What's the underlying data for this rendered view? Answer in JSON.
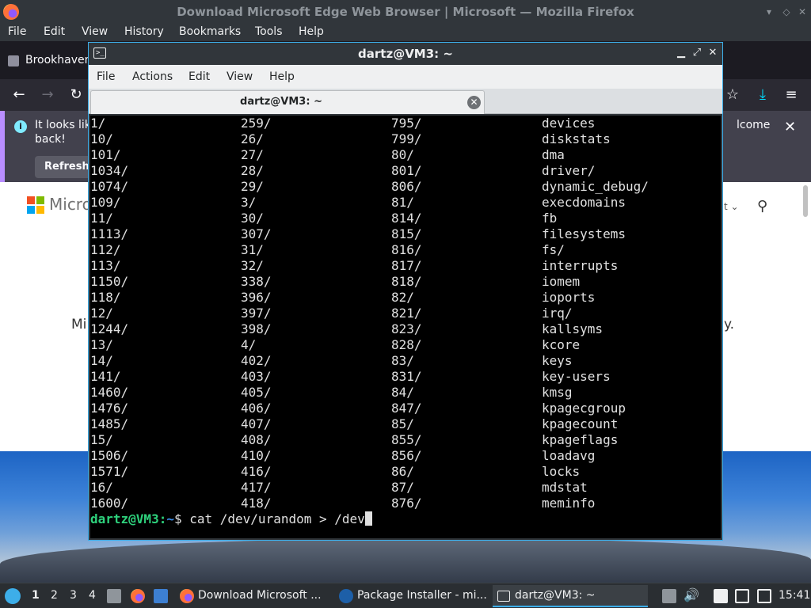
{
  "firefox": {
    "window_title": "Download Microsoft Edge Web Browser | Microsoft — Mozilla Firefox",
    "menu": [
      "File",
      "Edit",
      "View",
      "History",
      "Bookmarks",
      "Tools",
      "Help"
    ],
    "tab_title": "Brookhaven",
    "notice": {
      "line1": "It looks lik",
      "line2": "back!",
      "line1_right": "lcome",
      "refresh_label": "Refresh"
    },
    "content": {
      "ms_text": "Micro",
      "body_left": "Mi",
      "body_right": "y."
    }
  },
  "terminal": {
    "window_title": "dartz@VM3: ~",
    "menu": [
      "File",
      "Actions",
      "Edit",
      "View",
      "Help"
    ],
    "tab_title": "dartz@VM3: ~",
    "rows": [
      [
        "1/",
        "259/",
        "795/",
        "devices"
      ],
      [
        "10/",
        "26/",
        "799/",
        "diskstats"
      ],
      [
        "101/",
        "27/",
        "80/",
        "dma"
      ],
      [
        "1034/",
        "28/",
        "801/",
        "driver/"
      ],
      [
        "1074/",
        "29/",
        "806/",
        "dynamic_debug/"
      ],
      [
        "109/",
        "3/",
        "81/",
        "execdomains"
      ],
      [
        "11/",
        "30/",
        "814/",
        "fb"
      ],
      [
        "1113/",
        "307/",
        "815/",
        "filesystems"
      ],
      [
        "112/",
        "31/",
        "816/",
        "fs/"
      ],
      [
        "113/",
        "32/",
        "817/",
        "interrupts"
      ],
      [
        "1150/",
        "338/",
        "818/",
        "iomem"
      ],
      [
        "118/",
        "396/",
        "82/",
        "ioports"
      ],
      [
        "12/",
        "397/",
        "821/",
        "irq/"
      ],
      [
        "1244/",
        "398/",
        "823/",
        "kallsyms"
      ],
      [
        "13/",
        "4/",
        "828/",
        "kcore"
      ],
      [
        "14/",
        "402/",
        "83/",
        "keys"
      ],
      [
        "141/",
        "403/",
        "831/",
        "key-users"
      ],
      [
        "1460/",
        "405/",
        "84/",
        "kmsg"
      ],
      [
        "1476/",
        "406/",
        "847/",
        "kpagecgroup"
      ],
      [
        "1485/",
        "407/",
        "85/",
        "kpagecount"
      ],
      [
        "15/",
        "408/",
        "855/",
        "kpageflags"
      ],
      [
        "1506/",
        "410/",
        "856/",
        "loadavg"
      ],
      [
        "1571/",
        "416/",
        "86/",
        "locks"
      ],
      [
        "16/",
        "417/",
        "87/",
        "mdstat"
      ],
      [
        "1600/",
        "418/",
        "876/",
        "meminfo"
      ]
    ],
    "prompt_user": "dartz@VM3:",
    "prompt_path": "~",
    "prompt_symbol": "$ ",
    "command": "cat /dev/urandom > /dev"
  },
  "taskbar": {
    "desktops": [
      "1",
      "2",
      "3",
      "4"
    ],
    "windows": [
      "Download Microsoft ...",
      "Package Installer - mi...",
      "dartz@VM3: ~"
    ],
    "clock": "15:41"
  },
  "colors": {
    "accent": "#3daee9",
    "prompt_user": "#2ed17c",
    "prompt_path": "#3b8eea"
  }
}
